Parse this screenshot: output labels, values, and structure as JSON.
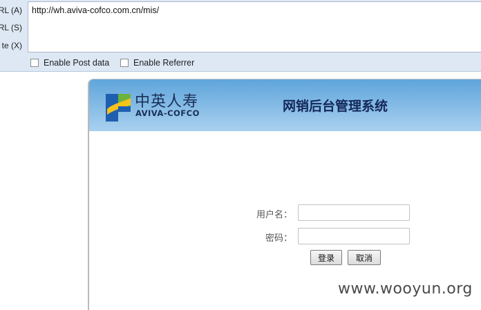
{
  "toolbar": {
    "labels": [
      "RL (A)",
      "RL (S)",
      "te (X)"
    ],
    "url_value": "http://wh.aviva-cofco.com.cn/mis/",
    "enable_post_label": "Enable Post data",
    "enable_referrer_label": "Enable Referrer"
  },
  "panel": {
    "logo_cn": "中英人寿",
    "logo_en": "AVIVA-COFCO",
    "system_title": "网销后台管理系统",
    "username_label": "用户名：",
    "password_label": "密码：",
    "login_button": "登录",
    "cancel_button": "取消"
  },
  "watermark": "www.wooyun.org",
  "colors": {
    "banner_top": "#5fa5db",
    "banner_bottom": "#a9d0ef",
    "logo_blue": "#1f5fb0",
    "logo_yellow": "#f6c21c",
    "logo_green": "#6cb33e"
  },
  "icons": [
    "aviva-cofco-logo-icon",
    "checkbox-icon"
  ]
}
